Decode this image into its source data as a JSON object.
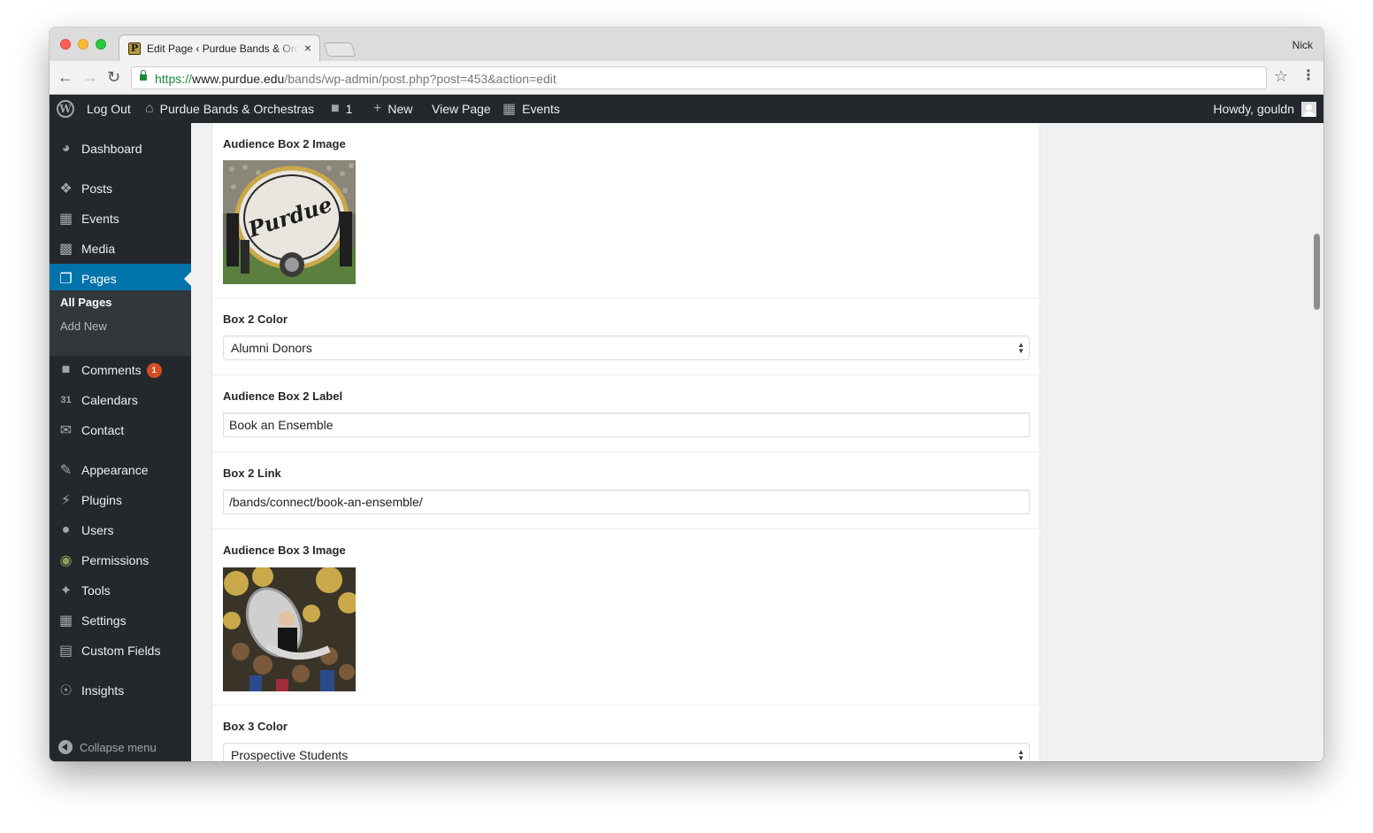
{
  "browser": {
    "tab_title": "Edit Page ‹ Purdue Bands & Orchestras — WordPress",
    "tab_close": "×",
    "profile_name": "Nick",
    "url_scheme": "https://",
    "url_host": "www.purdue.edu",
    "url_path": "/bands/wp-admin/post.php?post=453&action=edit",
    "icons": [
      "back-arrow-icon",
      "forward-arrow-icon",
      "reload-icon",
      "lock-icon",
      "star-icon",
      "menu-icon"
    ]
  },
  "adminbar": {
    "logout": "Log Out",
    "site_name": "Purdue Bands & Orchestras",
    "comments_count": "1",
    "new": "New",
    "view_page": "View Page",
    "events": "Events",
    "howdy": "Howdy, gouldn"
  },
  "menu": {
    "items": [
      {
        "label": "Dashboard",
        "icon": "dashboard-icon"
      },
      {
        "label": "Posts",
        "icon": "pin-icon"
      },
      {
        "label": "Events",
        "icon": "calendar-icon"
      },
      {
        "label": "Media",
        "icon": "media-icon"
      },
      {
        "label": "Pages",
        "icon": "pages-icon"
      },
      {
        "label": "Comments",
        "icon": "comment-icon",
        "badge": "1"
      },
      {
        "label": "Calendars",
        "icon": "calendar-31-icon"
      },
      {
        "label": "Contact",
        "icon": "envelope-icon"
      },
      {
        "label": "Appearance",
        "icon": "brush-icon"
      },
      {
        "label": "Plugins",
        "icon": "plug-icon"
      },
      {
        "label": "Users",
        "icon": "user-icon"
      },
      {
        "label": "Permissions",
        "icon": "people-icon"
      },
      {
        "label": "Tools",
        "icon": "wrench-icon"
      },
      {
        "label": "Settings",
        "icon": "sliders-icon"
      },
      {
        "label": "Custom Fields",
        "icon": "table-icon"
      },
      {
        "label": "Insights",
        "icon": "insights-icon"
      }
    ],
    "submenu": {
      "all_pages": "All Pages",
      "add_new": "Add New"
    },
    "collapse": "Collapse menu",
    "accent": "#0073aa"
  },
  "fields": {
    "box2_image_label": "Audience Box 2 Image",
    "box2_color_label": "Box 2 Color",
    "box2_color_value": "Alumni Donors",
    "box2_label_label": "Audience Box 2 Label",
    "box2_label_value": "Book an Ensemble",
    "box2_link_label": "Box 2 Link",
    "box2_link_value": "/bands/connect/book-an-ensemble/",
    "box3_image_label": "Audience Box 3 Image",
    "box3_color_label": "Box 3 Color",
    "box3_color_value": "Prospective Students"
  }
}
